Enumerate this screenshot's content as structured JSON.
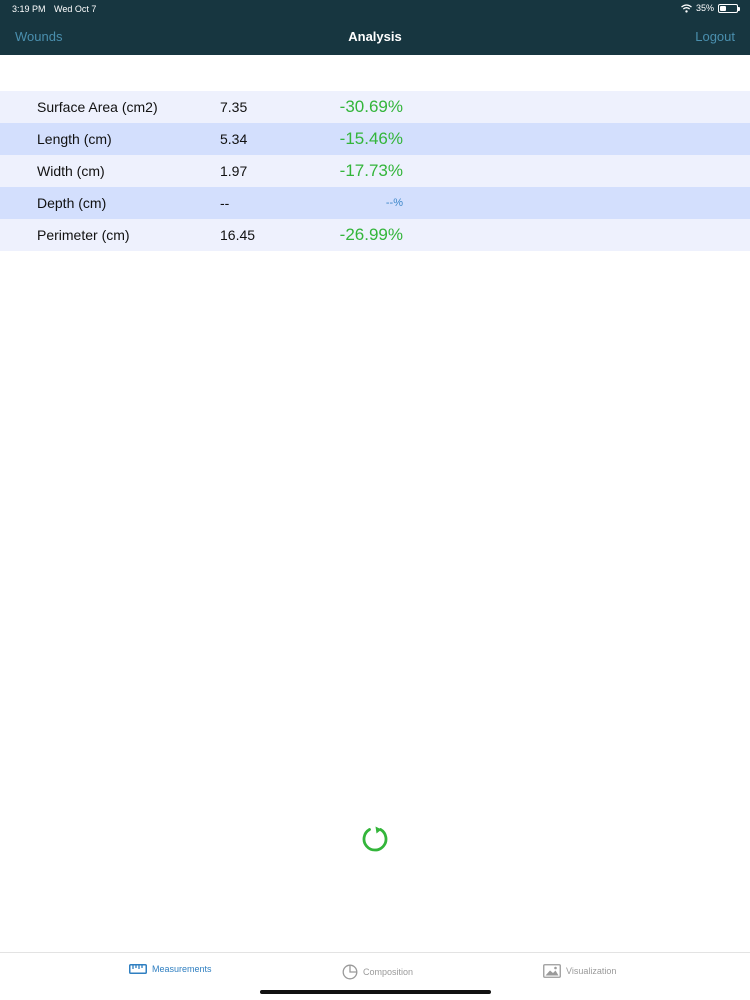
{
  "status_bar": {
    "time": "3:19 PM",
    "date": "Wed Oct 7",
    "battery": "35%",
    "battery_level": 0.35,
    "wifi_icon": "wifi-icon",
    "battery_icon": "battery-icon"
  },
  "nav": {
    "back_label": "Wounds",
    "title": "Analysis",
    "logout_label": "Logout"
  },
  "measurements": [
    {
      "label": "Surface Area (cm2)",
      "value": "7.35",
      "change": "-30.69%"
    },
    {
      "label": "Length (cm)",
      "value": "5.34",
      "change": "-15.46%"
    },
    {
      "label": "Width (cm)",
      "value": "1.97",
      "change": "-17.73%"
    },
    {
      "label": "Depth (cm)",
      "value": "--",
      "change": "--%"
    },
    {
      "label": "Perimeter (cm)",
      "value": "16.45",
      "change": "-26.99%"
    }
  ],
  "refresh_icon": "refresh-icon",
  "colors": {
    "nav_bg": "#173640",
    "nav_link": "#4a8fae",
    "positive_change": "#33b53a",
    "accent": "#2f7fc1",
    "row_light": "#eef1fd",
    "row_dark": "#d3dffd"
  },
  "tabs": [
    {
      "label": "Measurements",
      "icon": "ruler-icon",
      "active": true
    },
    {
      "label": "Composition",
      "icon": "pie-chart-icon",
      "active": false
    },
    {
      "label": "Visualization",
      "icon": "image-icon",
      "active": false
    }
  ]
}
